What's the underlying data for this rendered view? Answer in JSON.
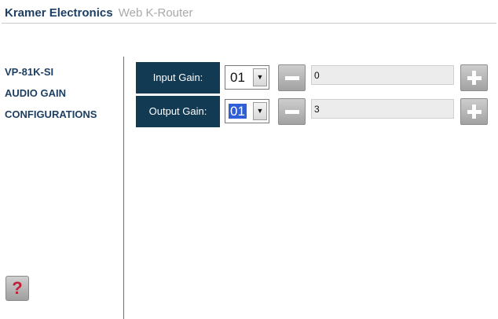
{
  "header": {
    "brand": "Kramer Electronics",
    "app_name": "Web K-Router"
  },
  "sidebar": {
    "title_lines": [
      "VP-81K-SI",
      "AUDIO GAIN",
      "CONFIGURATIONS"
    ],
    "help_label": "?"
  },
  "gain_rows": [
    {
      "label": "Input Gain:",
      "channel": "01",
      "channel_selected": false,
      "value": "0"
    },
    {
      "label": "Output Gain:",
      "channel": "01",
      "channel_selected": true,
      "value": "3"
    }
  ],
  "colors": {
    "brand_text": "#1d3f63",
    "label_background": "#123a53",
    "divider": "#d6453a",
    "help_mark": "#c0203a",
    "selection": "#2f5ed9"
  },
  "icons": {
    "minus": "minus-icon",
    "plus": "plus-icon",
    "dropdown": "chevron-down-icon",
    "help": "question-mark-icon"
  }
}
